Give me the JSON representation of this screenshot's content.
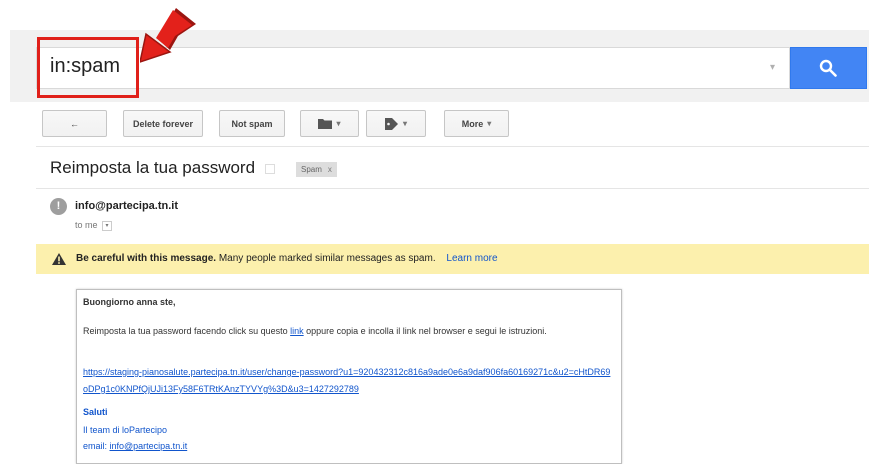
{
  "search": {
    "query": "in:spam"
  },
  "toolbar": {
    "back_label": "←",
    "delete_forever_label": "Delete forever",
    "not_spam_label": "Not spam",
    "more_label": "More",
    "caret": "▾"
  },
  "message": {
    "subject": "Reimposta la tua password",
    "label": "Spam",
    "label_remove": "x",
    "sender": "info@partecipa.tn.it",
    "recipient": "to me",
    "sender_icon_text": "!"
  },
  "warning": {
    "bold_text": "Be careful with this message.",
    "text": "Many people marked similar messages as spam.",
    "link": "Learn more"
  },
  "body": {
    "greeting": "Buongiorno anna ste,",
    "line1_before": "Reimposta la tua password facendo click su questo ",
    "line1_link": "link",
    "line1_after": " oppure copia e incolla il link nel browser e segui le istruzioni.",
    "url": "https://staging-pianosalute.partecipa.tn.it/user/change-password?u1=920432312c816a9ade0e6a9daf906fa60169271c&u2=cHtDR69oDPg1c0KNPfQjUJi13Fy58F6TRtKAnzTYVYg%3D&u3=1427292789",
    "saluti": "Saluti",
    "team": "Il team di loPartecipo",
    "email_label": "email: ",
    "email_link": "info@partecipa.tn.it"
  },
  "colors": {
    "search_button": "#4285f4",
    "highlight": "#e0201a",
    "warning_bg": "#fcf0ad",
    "link": "#1155cc"
  },
  "icons": {
    "search": "search-icon",
    "back": "back-arrow-icon",
    "folder": "folder-icon",
    "tag": "tag-icon",
    "warning": "warning-icon",
    "annotation": "red-arrow-icon"
  }
}
